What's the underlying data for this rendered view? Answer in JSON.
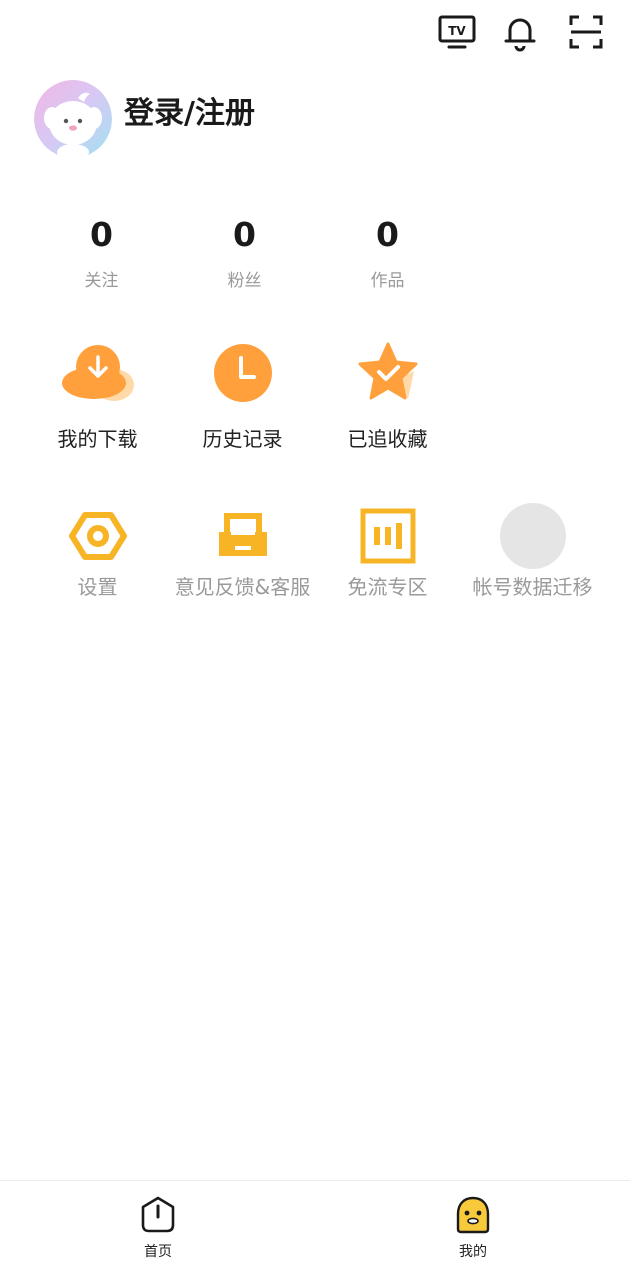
{
  "topbar": {
    "icons": [
      "tv-icon",
      "bell-icon",
      "scan-icon"
    ],
    "tv_text": "TV"
  },
  "profile": {
    "login_label": "登录/注册"
  },
  "stats": [
    {
      "value": "0",
      "label": "关注"
    },
    {
      "value": "0",
      "label": "粉丝"
    },
    {
      "value": "0",
      "label": "作品"
    }
  ],
  "features": [
    {
      "label": "我的下载",
      "icon": "cloud-download-icon"
    },
    {
      "label": "历史记录",
      "icon": "clock-icon"
    },
    {
      "label": "已追收藏",
      "icon": "star-check-icon"
    }
  ],
  "tools": [
    {
      "label": "设置",
      "icon": "hexagon-gear-icon"
    },
    {
      "label": "意见反馈&客服",
      "icon": "inbox-feedback-icon"
    },
    {
      "label": "免流专区",
      "icon": "bars-box-icon"
    },
    {
      "label": "帐号数据迁移",
      "icon": "placeholder-circle-icon"
    }
  ],
  "bottom_nav": [
    {
      "label": "首页",
      "icon": "home-icon"
    },
    {
      "label": "我的",
      "icon": "mascot-icon",
      "active": true
    }
  ],
  "colors": {
    "accent_orange": "#FFA03C",
    "accent_yellow": "#F7B526",
    "mascot_yellow": "#F8C93A",
    "text_dark": "#1a1a1a",
    "text_gray": "#9a9a9a"
  }
}
